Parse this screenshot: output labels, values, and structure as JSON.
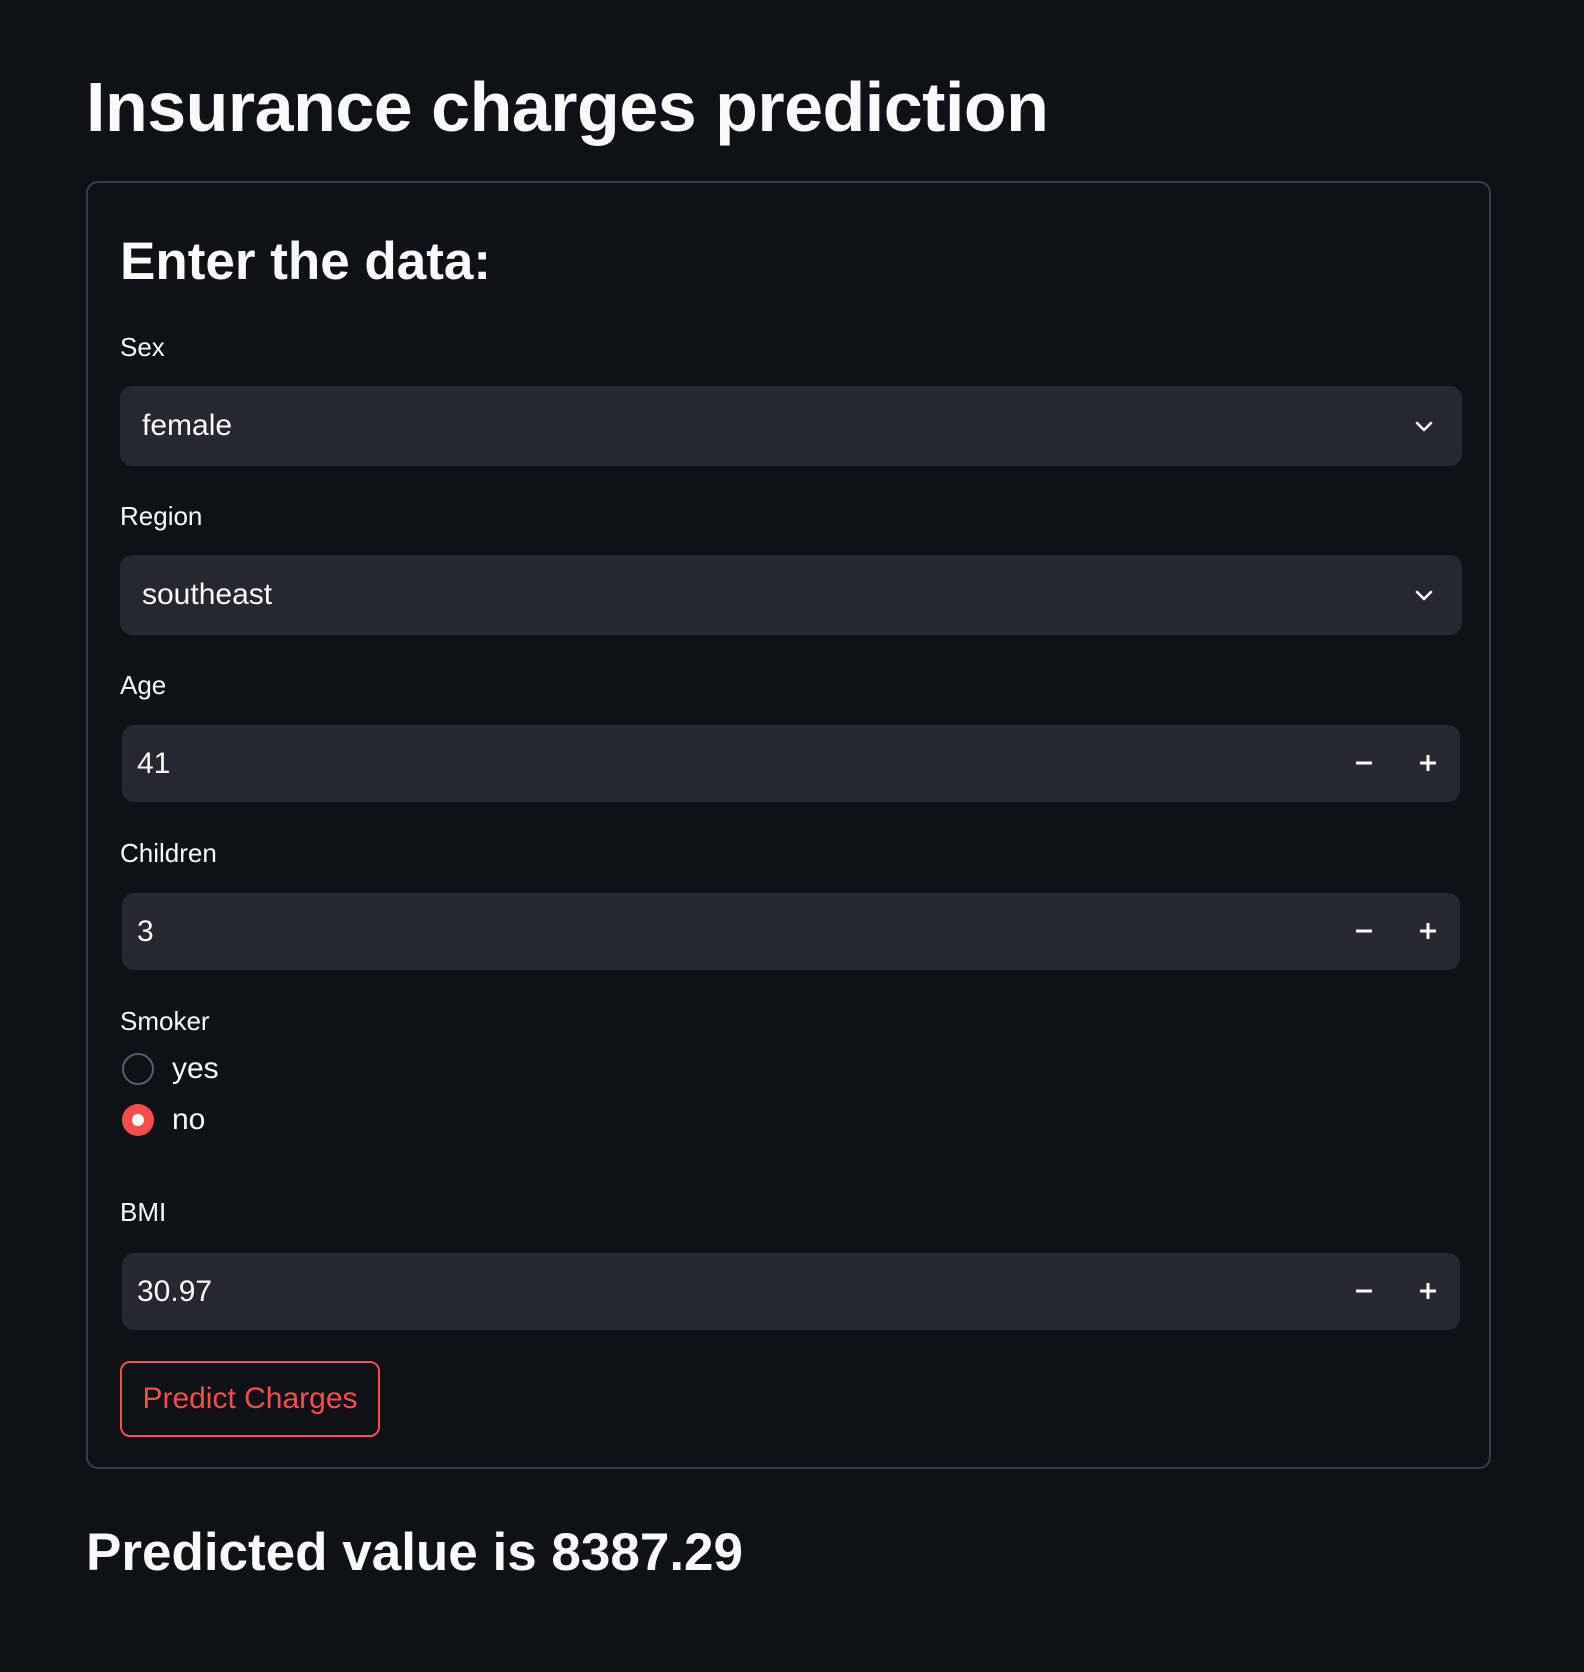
{
  "page": {
    "title": "Insurance charges prediction"
  },
  "form": {
    "heading": "Enter the data:",
    "sex": {
      "label": "Sex",
      "value": "female"
    },
    "region": {
      "label": "Region",
      "value": "southeast"
    },
    "age": {
      "label": "Age",
      "value": "41"
    },
    "children": {
      "label": "Children",
      "value": "3"
    },
    "smoker": {
      "label": "Smoker",
      "options": [
        "yes",
        "no"
      ],
      "selected": "no"
    },
    "bmi": {
      "label": "BMI",
      "value": "30.97"
    },
    "submit_label": "Predict Charges"
  },
  "result": {
    "text": "Predicted value is 8387.29"
  },
  "colors": {
    "background": "#0e1117",
    "input_background": "#262730",
    "accent": "#ff4b4b",
    "text": "#fafafa"
  },
  "icons": [
    "chevron-down-icon",
    "minus-icon",
    "plus-icon"
  ]
}
